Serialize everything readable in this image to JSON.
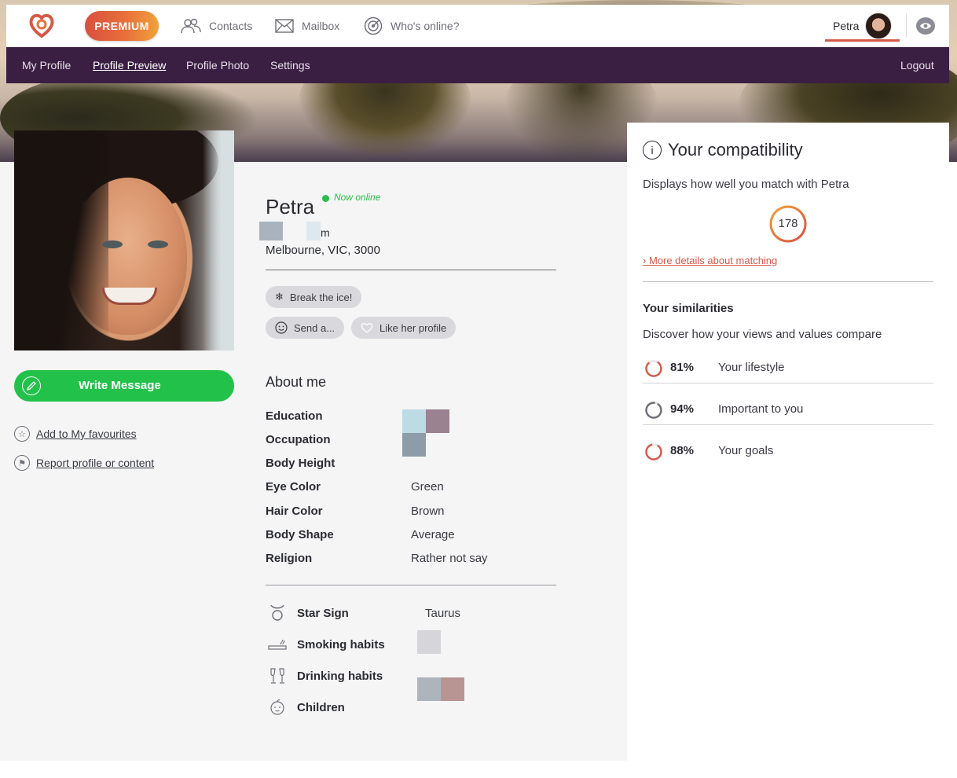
{
  "nav": {
    "premium_label": "PREMIUM",
    "items": [
      {
        "label": "Contacts",
        "icon": "contacts-icon"
      },
      {
        "label": "Mailbox",
        "icon": "mailbox-icon"
      },
      {
        "label": "Who's online?",
        "icon": "radar-icon"
      }
    ],
    "user_name": "Petra"
  },
  "subnav": {
    "items": [
      "My Profile",
      "Profile Preview",
      "Profile Photo",
      "Settings"
    ],
    "active": "Profile Preview",
    "logout_label": "Logout"
  },
  "profile": {
    "name": "Petra",
    "online_status": "Now online",
    "age_suffix": "m",
    "location": "Melbourne, VIC, 3000",
    "actions": {
      "break_ice": "Break the ice!",
      "send": "Send a...",
      "like": "Like her profile"
    },
    "write_message": "Write Message",
    "add_favourite": "Add to My favourites",
    "report": "Report profile or content"
  },
  "about": {
    "title": "About me",
    "rows": [
      {
        "label": "Education",
        "value": ""
      },
      {
        "label": "Occupation",
        "value": ""
      },
      {
        "label": "Body Height",
        "value": ""
      },
      {
        "label": "Eye Color",
        "value": "Green"
      },
      {
        "label": "Hair Color",
        "value": "Brown"
      },
      {
        "label": "Body Shape",
        "value": "Average"
      },
      {
        "label": "Religion",
        "value": "Rather not say"
      }
    ],
    "extra": [
      {
        "label": "Star Sign",
        "value": "Taurus",
        "icon": "taurus-icon"
      },
      {
        "label": "Smoking habits",
        "value": "",
        "icon": "cigarette-icon"
      },
      {
        "label": "Drinking habits",
        "value": "",
        "icon": "champagne-icon"
      },
      {
        "label": "Children",
        "value": "",
        "icon": "baby-icon"
      }
    ]
  },
  "compatibility": {
    "title": "Your compatibility",
    "subtitle": "Displays how well you match with Petra",
    "score": "178",
    "more_link": "More details about matching",
    "similarities_title": "Your similarities",
    "similarities_sub": "Discover how your views and values compare",
    "similarities": [
      {
        "pct": "81%",
        "label": "Your lifestyle",
        "value": 0.81,
        "color": "#d45a48"
      },
      {
        "pct": "94%",
        "label": "Important to you",
        "value": 0.94,
        "color": "#6e6e78"
      },
      {
        "pct": "88%",
        "label": "Your goals",
        "value": 0.88,
        "color": "#d45a48"
      }
    ]
  },
  "colors": {
    "accent": "#d45a48",
    "nav_purple": "#3b1f43",
    "online_green": "#2bbd4c",
    "message_green": "#22c24a"
  }
}
